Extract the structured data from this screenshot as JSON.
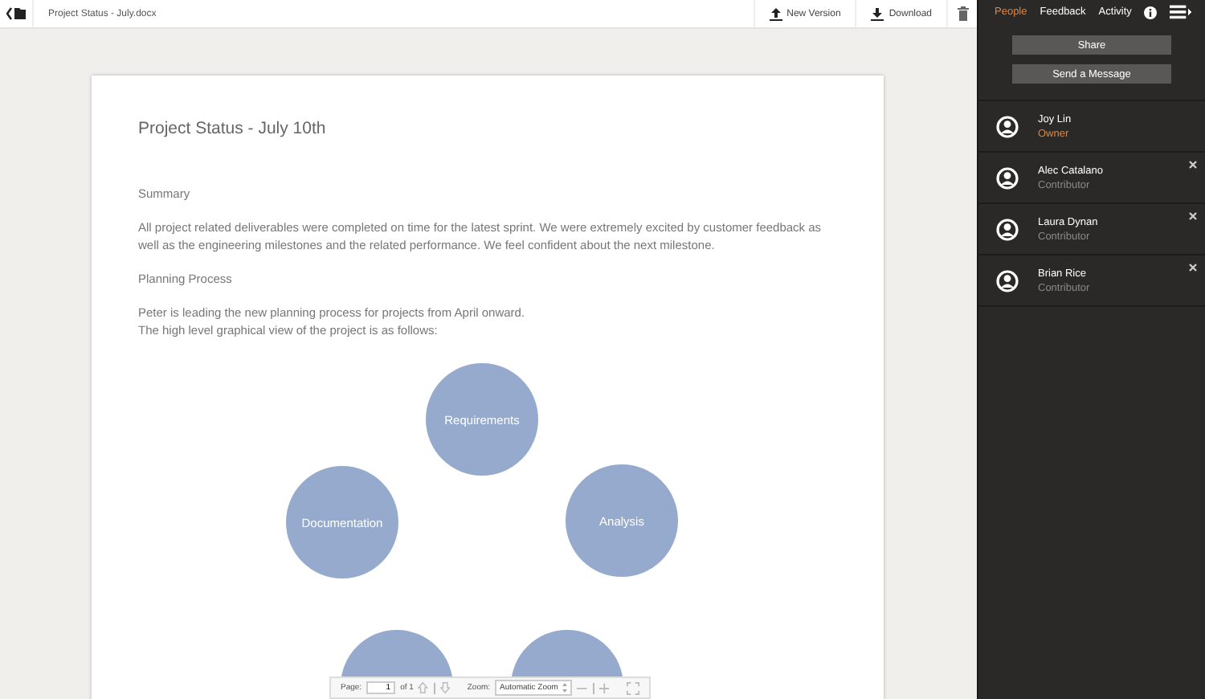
{
  "toolbar": {
    "file_name": "Project Status - July.docx",
    "actions": [
      {
        "label": "New Version"
      },
      {
        "label": "Download"
      }
    ]
  },
  "sidebar": {
    "tabs": [
      {
        "label": "People",
        "selected": true
      },
      {
        "label": "Feedback",
        "selected": false
      },
      {
        "label": "Activity",
        "selected": false
      }
    ],
    "buttons": [
      "Share",
      "Send a Message"
    ],
    "people": [
      {
        "name": "Joy Lin",
        "role": "Owner",
        "kind": "owner",
        "removable": false
      },
      {
        "name": "Alec Catalano",
        "role": "Contributor",
        "kind": "contributor",
        "removable": true
      },
      {
        "name": "Laura Dynan",
        "role": "Contributor",
        "kind": "contributor",
        "removable": true
      },
      {
        "name": "Brian Rice",
        "role": "Contributor",
        "kind": "contributor",
        "removable": true
      }
    ]
  },
  "document": {
    "title": "Project Status - July 10th",
    "blocks": [
      {
        "kind": "heading",
        "lines": [
          "Summary"
        ]
      },
      {
        "kind": "paragraph",
        "lines": [
          "All project related deliverables were completed on time for the latest sprint.  We were extremely excited by customer feedback as",
          "well as the engineering milestones and the related performance.  We feel confident about the next milestone."
        ]
      },
      {
        "kind": "heading",
        "lines": [
          "Planning Process"
        ]
      },
      {
        "kind": "paragraph",
        "lines": [
          "Peter is leading the new planning process for projects from April onward.",
          "The high level graphical view of the project is as follows:"
        ]
      }
    ],
    "diagram": {
      "nodes": [
        {
          "label": "Requirements"
        },
        {
          "label": "Analysis"
        },
        {
          "label": "Documentation"
        }
      ]
    }
  },
  "viewer": {
    "page_label": "Page:",
    "page": "1",
    "page_count": "of 1",
    "zoom_label": "Zoom:",
    "zoom": "Automatic Zoom"
  }
}
